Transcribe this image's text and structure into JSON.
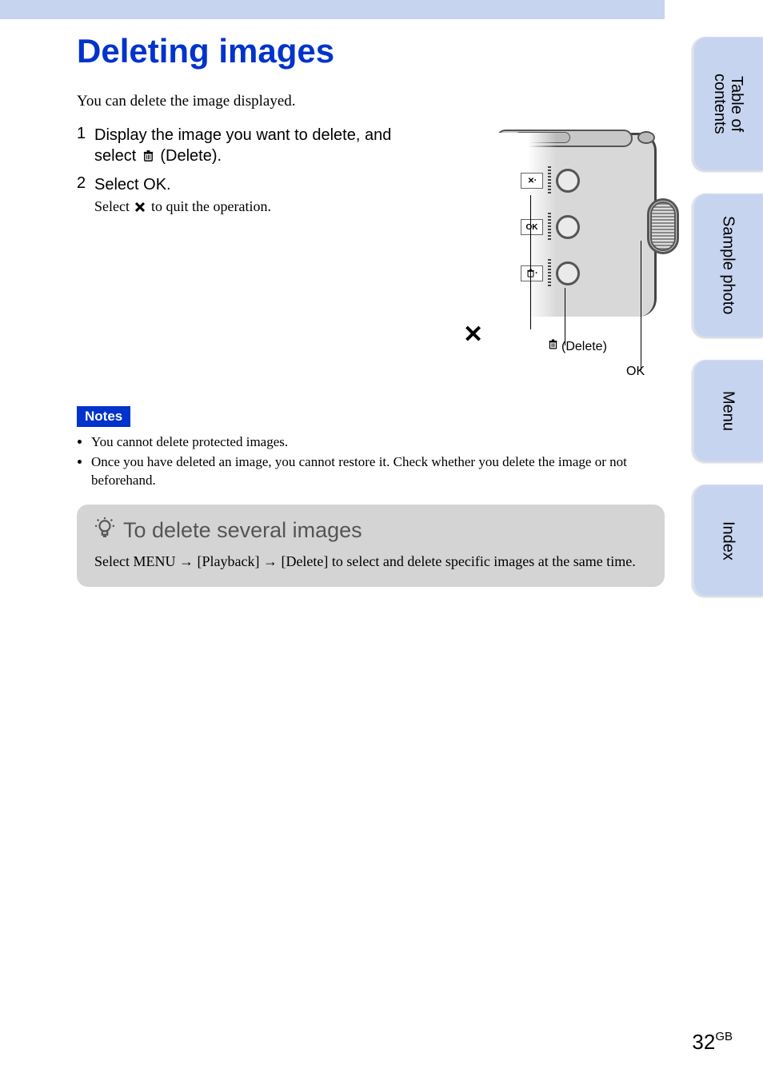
{
  "title": "Deleting images",
  "intro": "You can delete the image displayed.",
  "steps": [
    {
      "num": "1",
      "title_before": "Display the image you want to delete, and select ",
      "title_after": " (Delete).",
      "icon": "trash"
    },
    {
      "num": "2",
      "title_before": "Select OK.",
      "title_after": "",
      "sub_before": "Select ",
      "sub_after": " to quit the operation.",
      "sub_icon": "x"
    }
  ],
  "illustration": {
    "label_x": "✕",
    "label_delete": "(Delete)",
    "label_ok": "OK",
    "btn_ok_text": "OK"
  },
  "notes": {
    "badge": "Notes",
    "items": [
      "You cannot delete protected images.",
      "Once you have deleted an image, you cannot restore it. Check whether you delete the image or not beforehand."
    ]
  },
  "tip": {
    "heading": "To delete several images",
    "body": "Select MENU → [Playback] → [Delete] to select and delete specific images at the same time."
  },
  "side_tabs": {
    "toc_line1": "Table of",
    "toc_line2": "contents",
    "sample": "Sample photo",
    "menu": "Menu",
    "index": "Index"
  },
  "page_number": {
    "num": "32",
    "suffix": "GB"
  }
}
